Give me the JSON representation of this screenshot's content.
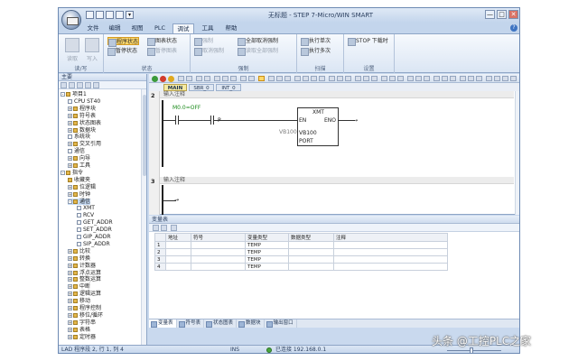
{
  "window": {
    "title": "无标题 - STEP 7-Micro/WIN SMART",
    "minimize": "—",
    "maximize": "□",
    "close": "✕"
  },
  "ribbon_tabs": [
    "文件",
    "编辑",
    "视图",
    "PLC",
    "调试",
    "工具",
    "帮助"
  ],
  "ribbon": {
    "read": "读取",
    "write": "写入",
    "group_readwrite": "读/写",
    "program_status": "程序状态",
    "pause_status": "暂停状态",
    "chart_status": "图表状态",
    "pause_chart": "暂停图表",
    "group_status": "状态",
    "force": "强制",
    "unforce": "取消强制",
    "unforce_all": "全部取消强制",
    "read_all_forced": "读取全部强制",
    "group_force": "强制",
    "execute_single": "执行单次",
    "execute_multiple": "执行多次",
    "group_scan": "扫描",
    "stop_download": "STOP 下载时",
    "group_settings": "设置"
  },
  "left_panel": {
    "title": "主要",
    "tree": [
      {
        "label": "项目1",
        "level": 0,
        "exp": "-",
        "icon": "folder"
      },
      {
        "label": "CPU ST40",
        "level": 1,
        "exp": "",
        "icon": "block"
      },
      {
        "label": "程序块",
        "level": 1,
        "exp": "+",
        "icon": "folder"
      },
      {
        "label": "符号表",
        "level": 1,
        "exp": "+",
        "icon": "folder"
      },
      {
        "label": "状态图表",
        "level": 1,
        "exp": "+",
        "icon": "folder"
      },
      {
        "label": "数据块",
        "level": 1,
        "exp": "+",
        "icon": "folder"
      },
      {
        "label": "系统块",
        "level": 1,
        "exp": "",
        "icon": "block"
      },
      {
        "label": "交叉引用",
        "level": 1,
        "exp": "+",
        "icon": "folder"
      },
      {
        "label": "通信",
        "level": 1,
        "exp": "",
        "icon": "block"
      },
      {
        "label": "向导",
        "level": 1,
        "exp": "+",
        "icon": "folder"
      },
      {
        "label": "工具",
        "level": 1,
        "exp": "+",
        "icon": "folder"
      },
      {
        "label": "指令",
        "level": 0,
        "exp": "-",
        "icon": "folder"
      },
      {
        "label": "收藏夹",
        "level": 1,
        "exp": "",
        "icon": "folder"
      },
      {
        "label": "位逻辑",
        "level": 1,
        "exp": "+",
        "icon": "folder"
      },
      {
        "label": "时钟",
        "level": 1,
        "exp": "+",
        "icon": "folder"
      },
      {
        "label": "通信",
        "level": 1,
        "exp": "-",
        "icon": "folder"
      },
      {
        "label": "XMT",
        "level": 2,
        "exp": "",
        "icon": "block"
      },
      {
        "label": "RCV",
        "level": 2,
        "exp": "",
        "icon": "block"
      },
      {
        "label": "GET_ADDR",
        "level": 2,
        "exp": "",
        "icon": "block"
      },
      {
        "label": "SET_ADDR",
        "level": 2,
        "exp": "",
        "icon": "block"
      },
      {
        "label": "GIP_ADDR",
        "level": 2,
        "exp": "",
        "icon": "block"
      },
      {
        "label": "SIP_ADDR",
        "level": 2,
        "exp": "",
        "icon": "block"
      },
      {
        "label": "比较",
        "level": 1,
        "exp": "+",
        "icon": "folder"
      },
      {
        "label": "转换",
        "level": 1,
        "exp": "+",
        "icon": "folder"
      },
      {
        "label": "计数器",
        "level": 1,
        "exp": "+",
        "icon": "folder"
      },
      {
        "label": "浮点运算",
        "level": 1,
        "exp": "+",
        "icon": "folder"
      },
      {
        "label": "整数运算",
        "level": 1,
        "exp": "+",
        "icon": "folder"
      },
      {
        "label": "中断",
        "level": 1,
        "exp": "+",
        "icon": "folder"
      },
      {
        "label": "逻辑运算",
        "level": 1,
        "exp": "+",
        "icon": "folder"
      },
      {
        "label": "移动",
        "level": 1,
        "exp": "+",
        "icon": "folder"
      },
      {
        "label": "程序控制",
        "level": 1,
        "exp": "+",
        "icon": "folder"
      },
      {
        "label": "移位/循环",
        "level": 1,
        "exp": "+",
        "icon": "folder"
      },
      {
        "label": "字符串",
        "level": 1,
        "exp": "+",
        "icon": "folder"
      },
      {
        "label": "表格",
        "level": 1,
        "exp": "+",
        "icon": "folder"
      },
      {
        "label": "定时器",
        "level": 1,
        "exp": "+",
        "icon": "folder"
      }
    ]
  },
  "editor": {
    "pou_tabs": [
      "MAIN",
      "SBR_0",
      "INT_0"
    ],
    "network1": {
      "number": "2",
      "comment": "输入注释",
      "contact_address": "M0.0=OFF",
      "p_label": "P",
      "box_name": "XMT",
      "box_en": "EN",
      "box_eno": "ENO",
      "tbl_param": "VB100",
      "tbl_value": "VB100",
      "port_label": "PORT"
    },
    "network2": {
      "number": "3",
      "comment": "输入注释"
    }
  },
  "var_table": {
    "title": "变量表",
    "headers": [
      "",
      "地址",
      "符号",
      "变量类型",
      "数据类型",
      "注释"
    ],
    "rows": [
      {
        "n": "1",
        "type": "TEMP"
      },
      {
        "n": "2",
        "type": "TEMP"
      },
      {
        "n": "3",
        "type": "TEMP"
      },
      {
        "n": "4",
        "type": "TEMP"
      }
    ]
  },
  "bottom_tabs": [
    "变量表",
    "符号表",
    "状态图表",
    "数据块",
    "输出窗口"
  ],
  "status": {
    "position": "LAD 程序段 2, 行 1, 列 4",
    "ins": "INS",
    "connected": "已连接 192.168.0.1"
  },
  "watermark": "头条 @工控PLC之家",
  "colors": {
    "accent": "#ffd86a",
    "status_ok": "#1a8a1a"
  }
}
